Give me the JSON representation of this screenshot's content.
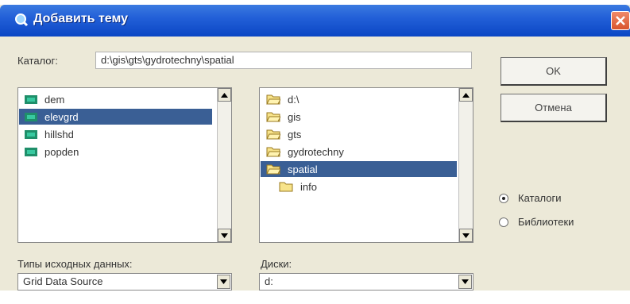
{
  "dialog": {
    "title": "Добавить тему"
  },
  "catalog": {
    "label": "Каталог:",
    "value": "d:\\gis\\gts\\gydrotechny\\spatial"
  },
  "buttons": {
    "ok": "OK",
    "cancel": "Отмена"
  },
  "themes": {
    "items": [
      {
        "label": "dem",
        "selected": false
      },
      {
        "label": "elevgrd",
        "selected": true
      },
      {
        "label": "hillshd",
        "selected": false
      },
      {
        "label": "popden",
        "selected": false
      }
    ]
  },
  "folders": {
    "items": [
      {
        "label": "d:\\",
        "selected": false
      },
      {
        "label": "gis",
        "selected": false
      },
      {
        "label": "gts",
        "selected": false
      },
      {
        "label": "gydrotechny",
        "selected": false
      },
      {
        "label": "spatial",
        "selected": true
      },
      {
        "label": "info",
        "selected": false
      }
    ]
  },
  "source_types": {
    "label": "Типы исходных данных:",
    "value": "Grid Data Source"
  },
  "drives": {
    "label": "Диски:",
    "value": "d:"
  },
  "view_mode": {
    "options": [
      {
        "label": "Каталоги",
        "checked": true
      },
      {
        "label": "Библиотеки",
        "checked": false
      }
    ]
  },
  "colors": {
    "titlebar": "#0a46c4",
    "selection": "#3a5f95",
    "dialog_bg": "#ece9d8"
  }
}
